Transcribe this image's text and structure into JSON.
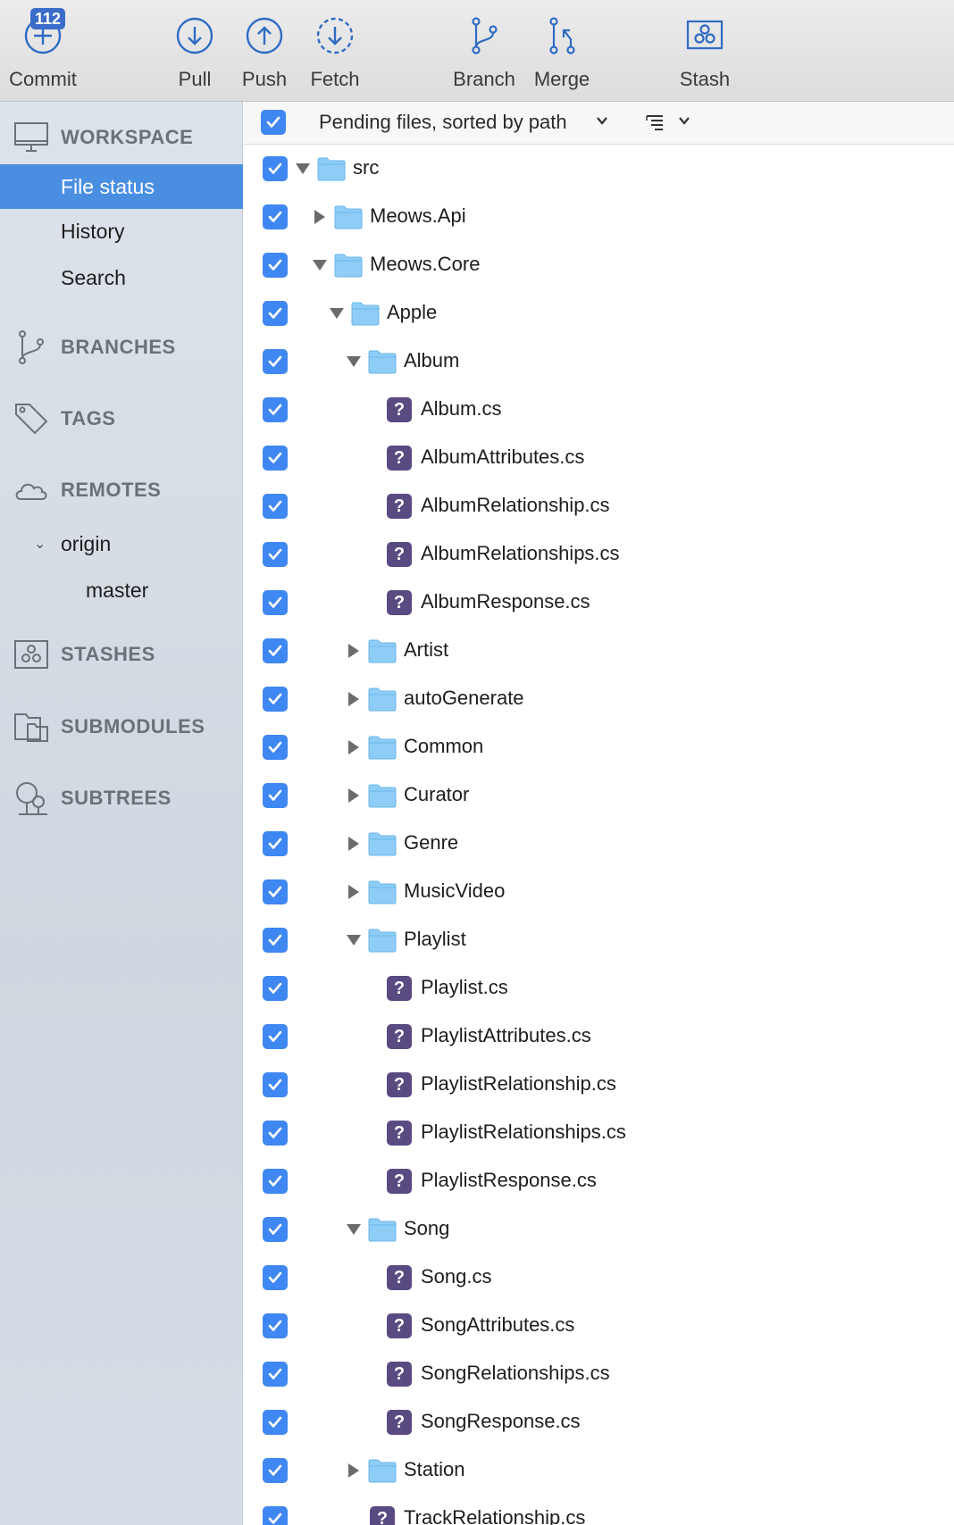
{
  "toolbar": {
    "commit": {
      "label": "Commit",
      "badge": "112"
    },
    "pull": {
      "label": "Pull"
    },
    "push": {
      "label": "Push"
    },
    "fetch": {
      "label": "Fetch"
    },
    "branch": {
      "label": "Branch"
    },
    "merge": {
      "label": "Merge"
    },
    "stash": {
      "label": "Stash"
    }
  },
  "sidebar": {
    "workspace": "WORKSPACE",
    "file_status": "File status",
    "history": "History",
    "search": "Search",
    "branches": "BRANCHES",
    "tags": "TAGS",
    "remotes": "REMOTES",
    "origin": "origin",
    "master": "master",
    "stashes": "STASHES",
    "submodules": "SUBMODULES",
    "subtrees": "SUBTREES"
  },
  "main": {
    "header_title": "Pending files, sorted by path",
    "rows": [
      {
        "name": "src",
        "type": "folder",
        "state": "expanded"
      },
      {
        "name": "Meows.Api",
        "type": "folder",
        "state": "collapsed"
      },
      {
        "name": "Meows.Core",
        "type": "folder",
        "state": "expanded"
      },
      {
        "name": "Apple",
        "type": "folder",
        "state": "expanded"
      },
      {
        "name": "Album",
        "type": "folder",
        "state": "expanded"
      },
      {
        "name": "Album.cs",
        "type": "file",
        "status": "untracked"
      },
      {
        "name": "AlbumAttributes.cs",
        "type": "file",
        "status": "untracked"
      },
      {
        "name": "AlbumRelationship.cs",
        "type": "file",
        "status": "untracked"
      },
      {
        "name": "AlbumRelationships.cs",
        "type": "file",
        "status": "untracked"
      },
      {
        "name": "AlbumResponse.cs",
        "type": "file",
        "status": "untracked"
      },
      {
        "name": "Artist",
        "type": "folder",
        "state": "collapsed"
      },
      {
        "name": "autoGenerate",
        "type": "folder",
        "state": "collapsed"
      },
      {
        "name": "Common",
        "type": "folder",
        "state": "collapsed"
      },
      {
        "name": "Curator",
        "type": "folder",
        "state": "collapsed"
      },
      {
        "name": "Genre",
        "type": "folder",
        "state": "collapsed"
      },
      {
        "name": "MusicVideo",
        "type": "folder",
        "state": "collapsed"
      },
      {
        "name": "Playlist",
        "type": "folder",
        "state": "expanded"
      },
      {
        "name": "Playlist.cs",
        "type": "file",
        "status": "untracked"
      },
      {
        "name": "PlaylistAttributes.cs",
        "type": "file",
        "status": "untracked"
      },
      {
        "name": "PlaylistRelationship.cs",
        "type": "file",
        "status": "untracked"
      },
      {
        "name": "PlaylistRelationships.cs",
        "type": "file",
        "status": "untracked"
      },
      {
        "name": "PlaylistResponse.cs",
        "type": "file",
        "status": "untracked"
      },
      {
        "name": "Song",
        "type": "folder",
        "state": "expanded"
      },
      {
        "name": "Song.cs",
        "type": "file",
        "status": "untracked"
      },
      {
        "name": "SongAttributes.cs",
        "type": "file",
        "status": "untracked"
      },
      {
        "name": "SongRelationships.cs",
        "type": "file",
        "status": "untracked"
      },
      {
        "name": "SongResponse.cs",
        "type": "file",
        "status": "untracked"
      },
      {
        "name": "Station",
        "type": "folder",
        "state": "collapsed"
      },
      {
        "name": "TrackRelationship.cs",
        "type": "file",
        "status": "untracked"
      }
    ]
  },
  "colors": {
    "accent": "#3f87f3",
    "selection": "#4a8ee2",
    "untracked_icon": "#5a4a82",
    "folder": "#7cc4f4",
    "toolbar_icon": "#2f6bc4"
  }
}
